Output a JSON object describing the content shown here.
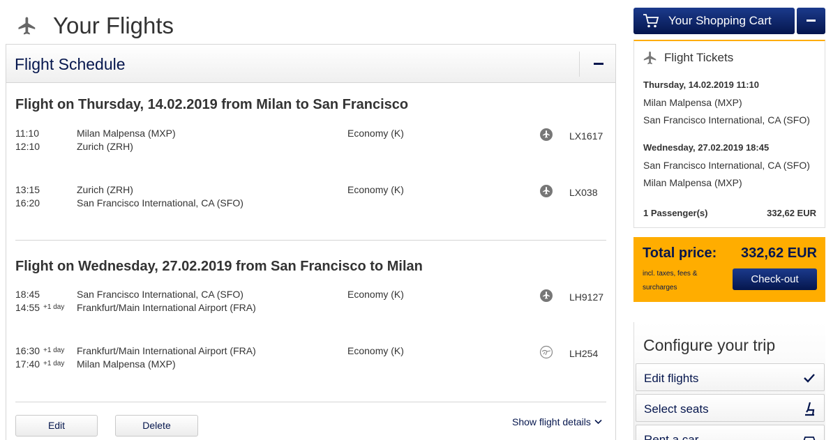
{
  "page": {
    "title": "Your Flights",
    "icon": "airplane-icon"
  },
  "schedule": {
    "title": "Flight Schedule",
    "bounds": [
      {
        "title": "Flight on Thursday, 14.02.2019 from Milan to San Francisco",
        "segments": [
          {
            "dep_time": "11:10",
            "dep_day": "",
            "arr_time": "12:10",
            "arr_day": "",
            "from": "Milan Malpensa (MXP)",
            "to": "Zurich (ZRH)",
            "cabin": "Economy (K)",
            "carrier_icon": "swiss-logo-icon",
            "flight": "LX1617"
          },
          {
            "dep_time": "13:15",
            "dep_day": "",
            "arr_time": "16:20",
            "arr_day": "",
            "from": "Zurich (ZRH)",
            "to": "San Francisco International, CA (SFO)",
            "cabin": "Economy (K)",
            "carrier_icon": "swiss-logo-icon",
            "flight": "LX038"
          }
        ]
      },
      {
        "title": "Flight on Wednesday, 27.02.2019 from San Francisco to Milan",
        "segments": [
          {
            "dep_time": "18:45",
            "dep_day": "",
            "arr_time": "14:55",
            "arr_day": "+1 day",
            "from": "San Francisco International, CA (SFO)",
            "to": "Frankfurt/Main International Airport (FRA)",
            "cabin": "Economy (K)",
            "carrier_icon": "swiss-logo-icon",
            "flight": "LH9127"
          },
          {
            "dep_time": "16:30",
            "dep_day": "+1 day",
            "arr_time": "17:40",
            "arr_day": "+1 day",
            "from": "Frankfurt/Main International Airport (FRA)",
            "to": "Milan Malpensa (MXP)",
            "cabin": "Economy (K)",
            "carrier_icon": "lufthansa-crane-icon",
            "flight": "LH254"
          }
        ]
      }
    ],
    "edit_label": "Edit",
    "delete_label": "Delete",
    "details_label": "Show flight details"
  },
  "cart": {
    "button_label": "Your Shopping Cart",
    "section_title": "Flight Tickets",
    "outbound": {
      "datetime": "Thursday, 14.02.2019 11:10",
      "from": "Milan Malpensa (MXP)",
      "to": "San Francisco International, CA (SFO)"
    },
    "inbound": {
      "datetime": "Wednesday, 27.02.2019 18:45",
      "from": "San Francisco International, CA (SFO)",
      "to": "Milan Malpensa (MXP)"
    },
    "passengers": "1 Passenger(s)",
    "subtotal": "332,62 EUR"
  },
  "total": {
    "label": "Total price:",
    "price": "332,62 EUR",
    "note": "incl. taxes, fees & surcharges",
    "checkout_label": "Check-out"
  },
  "configure": {
    "title": "Configure your trip",
    "items": [
      {
        "label": "Edit flights",
        "icon": "checkmark-icon"
      },
      {
        "label": "Select seats",
        "icon": "seat-icon"
      },
      {
        "label": "Rent a car",
        "icon": "car-icon"
      }
    ]
  },
  "colors": {
    "brand_navy": "#05164d",
    "accent_yellow": "#ffad00"
  }
}
